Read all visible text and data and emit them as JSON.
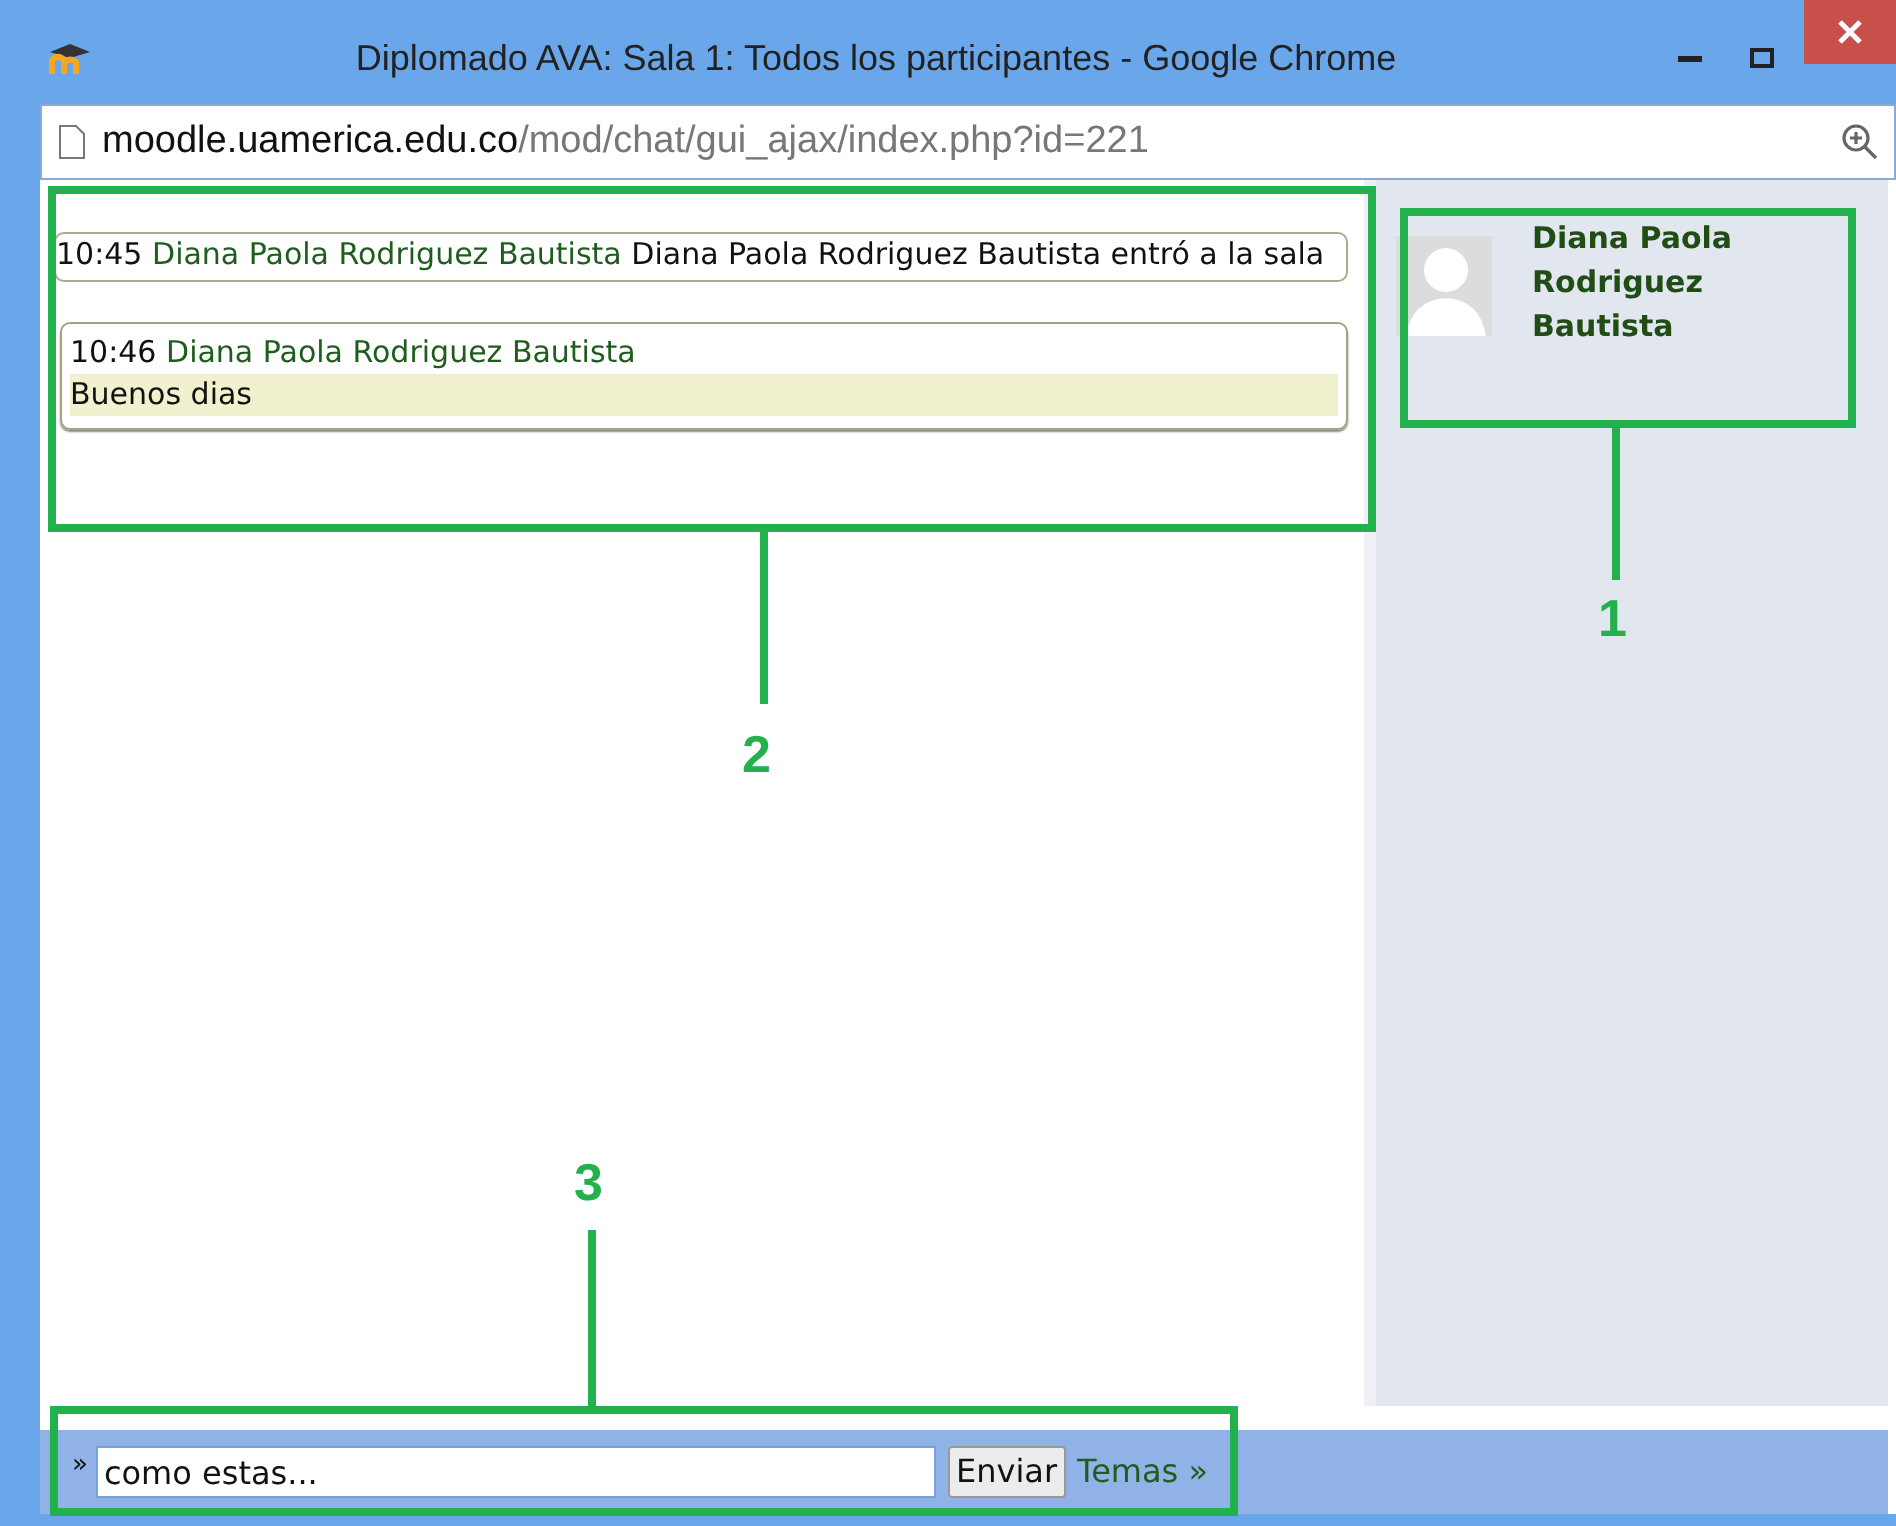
{
  "window": {
    "title": "Diplomado AVA: Sala 1: Todos los participantes - Google Chrome"
  },
  "address_bar": {
    "host": "moodle.uamerica.edu.co",
    "path": "/mod/chat/gui_ajax/index.php?id=221"
  },
  "messages": [
    {
      "kind": "event",
      "time": "10:45",
      "author": "Diana Paola Rodriguez Bautista",
      "text": "Diana Paola Rodriguez Bautista entró a la sala"
    },
    {
      "kind": "message",
      "time": "10:46",
      "author": "Diana Paola Rodriguez Bautista",
      "text": "Buenos dias"
    }
  ],
  "users": [
    {
      "name": "Diana Paola Rodriguez Bautista"
    }
  ],
  "input_bar": {
    "prompt": "»",
    "value": "como estas...",
    "send": "Enviar",
    "themes": "Temas »"
  },
  "annotations": [
    {
      "label": "1"
    },
    {
      "label": "2"
    },
    {
      "label": "3"
    }
  ]
}
